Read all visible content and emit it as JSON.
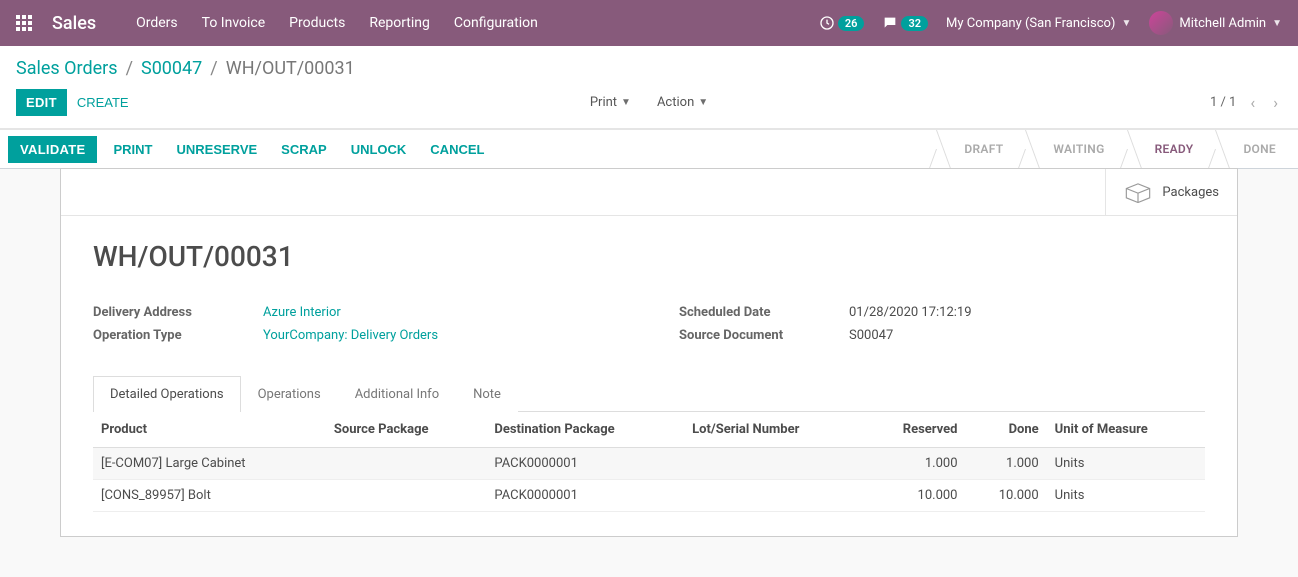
{
  "topbar": {
    "brand": "Sales",
    "menu": [
      "Orders",
      "To Invoice",
      "Products",
      "Reporting",
      "Configuration"
    ],
    "activity_count": "26",
    "messages_count": "32",
    "company": "My Company (San Francisco)",
    "user": "Mitchell Admin"
  },
  "breadcrumbs": {
    "root": "Sales Orders",
    "parent": "S00047",
    "current": "WH/OUT/00031"
  },
  "controls": {
    "edit": "EDIT",
    "create": "CREATE",
    "print": "Print",
    "action": "Action",
    "pager": "1 / 1"
  },
  "statusbar": {
    "validate": "VALIDATE",
    "print": "PRINT",
    "unreserve": "UNRESERVE",
    "scrap": "SCRAP",
    "unlock": "UNLOCK",
    "cancel": "CANCEL",
    "steps": [
      "DRAFT",
      "WAITING",
      "READY",
      "DONE"
    ],
    "active_step_index": 2
  },
  "sheet": {
    "packages_btn": "Packages",
    "title": "WH/OUT/00031",
    "left_fields": {
      "delivery_address_label": "Delivery Address",
      "delivery_address_value": "Azure Interior",
      "operation_type_label": "Operation Type",
      "operation_type_value": "YourCompany: Delivery Orders"
    },
    "right_fields": {
      "scheduled_date_label": "Scheduled Date",
      "scheduled_date_value": "01/28/2020 17:12:19",
      "source_doc_label": "Source Document",
      "source_doc_value": "S00047"
    },
    "tabs": [
      "Detailed Operations",
      "Operations",
      "Additional Info",
      "Note"
    ],
    "columns": {
      "product": "Product",
      "source_pkg": "Source Package",
      "dest_pkg": "Destination Package",
      "lot": "Lot/Serial Number",
      "reserved": "Reserved",
      "done": "Done",
      "uom": "Unit of Measure"
    },
    "rows": [
      {
        "product": "[E-COM07] Large Cabinet",
        "source_pkg": "",
        "dest_pkg": "PACK0000001",
        "lot": "",
        "reserved": "1.000",
        "done": "1.000",
        "uom": "Units"
      },
      {
        "product": "[CONS_89957] Bolt",
        "source_pkg": "",
        "dest_pkg": "PACK0000001",
        "lot": "",
        "reserved": "10.000",
        "done": "10.000",
        "uom": "Units"
      }
    ]
  }
}
